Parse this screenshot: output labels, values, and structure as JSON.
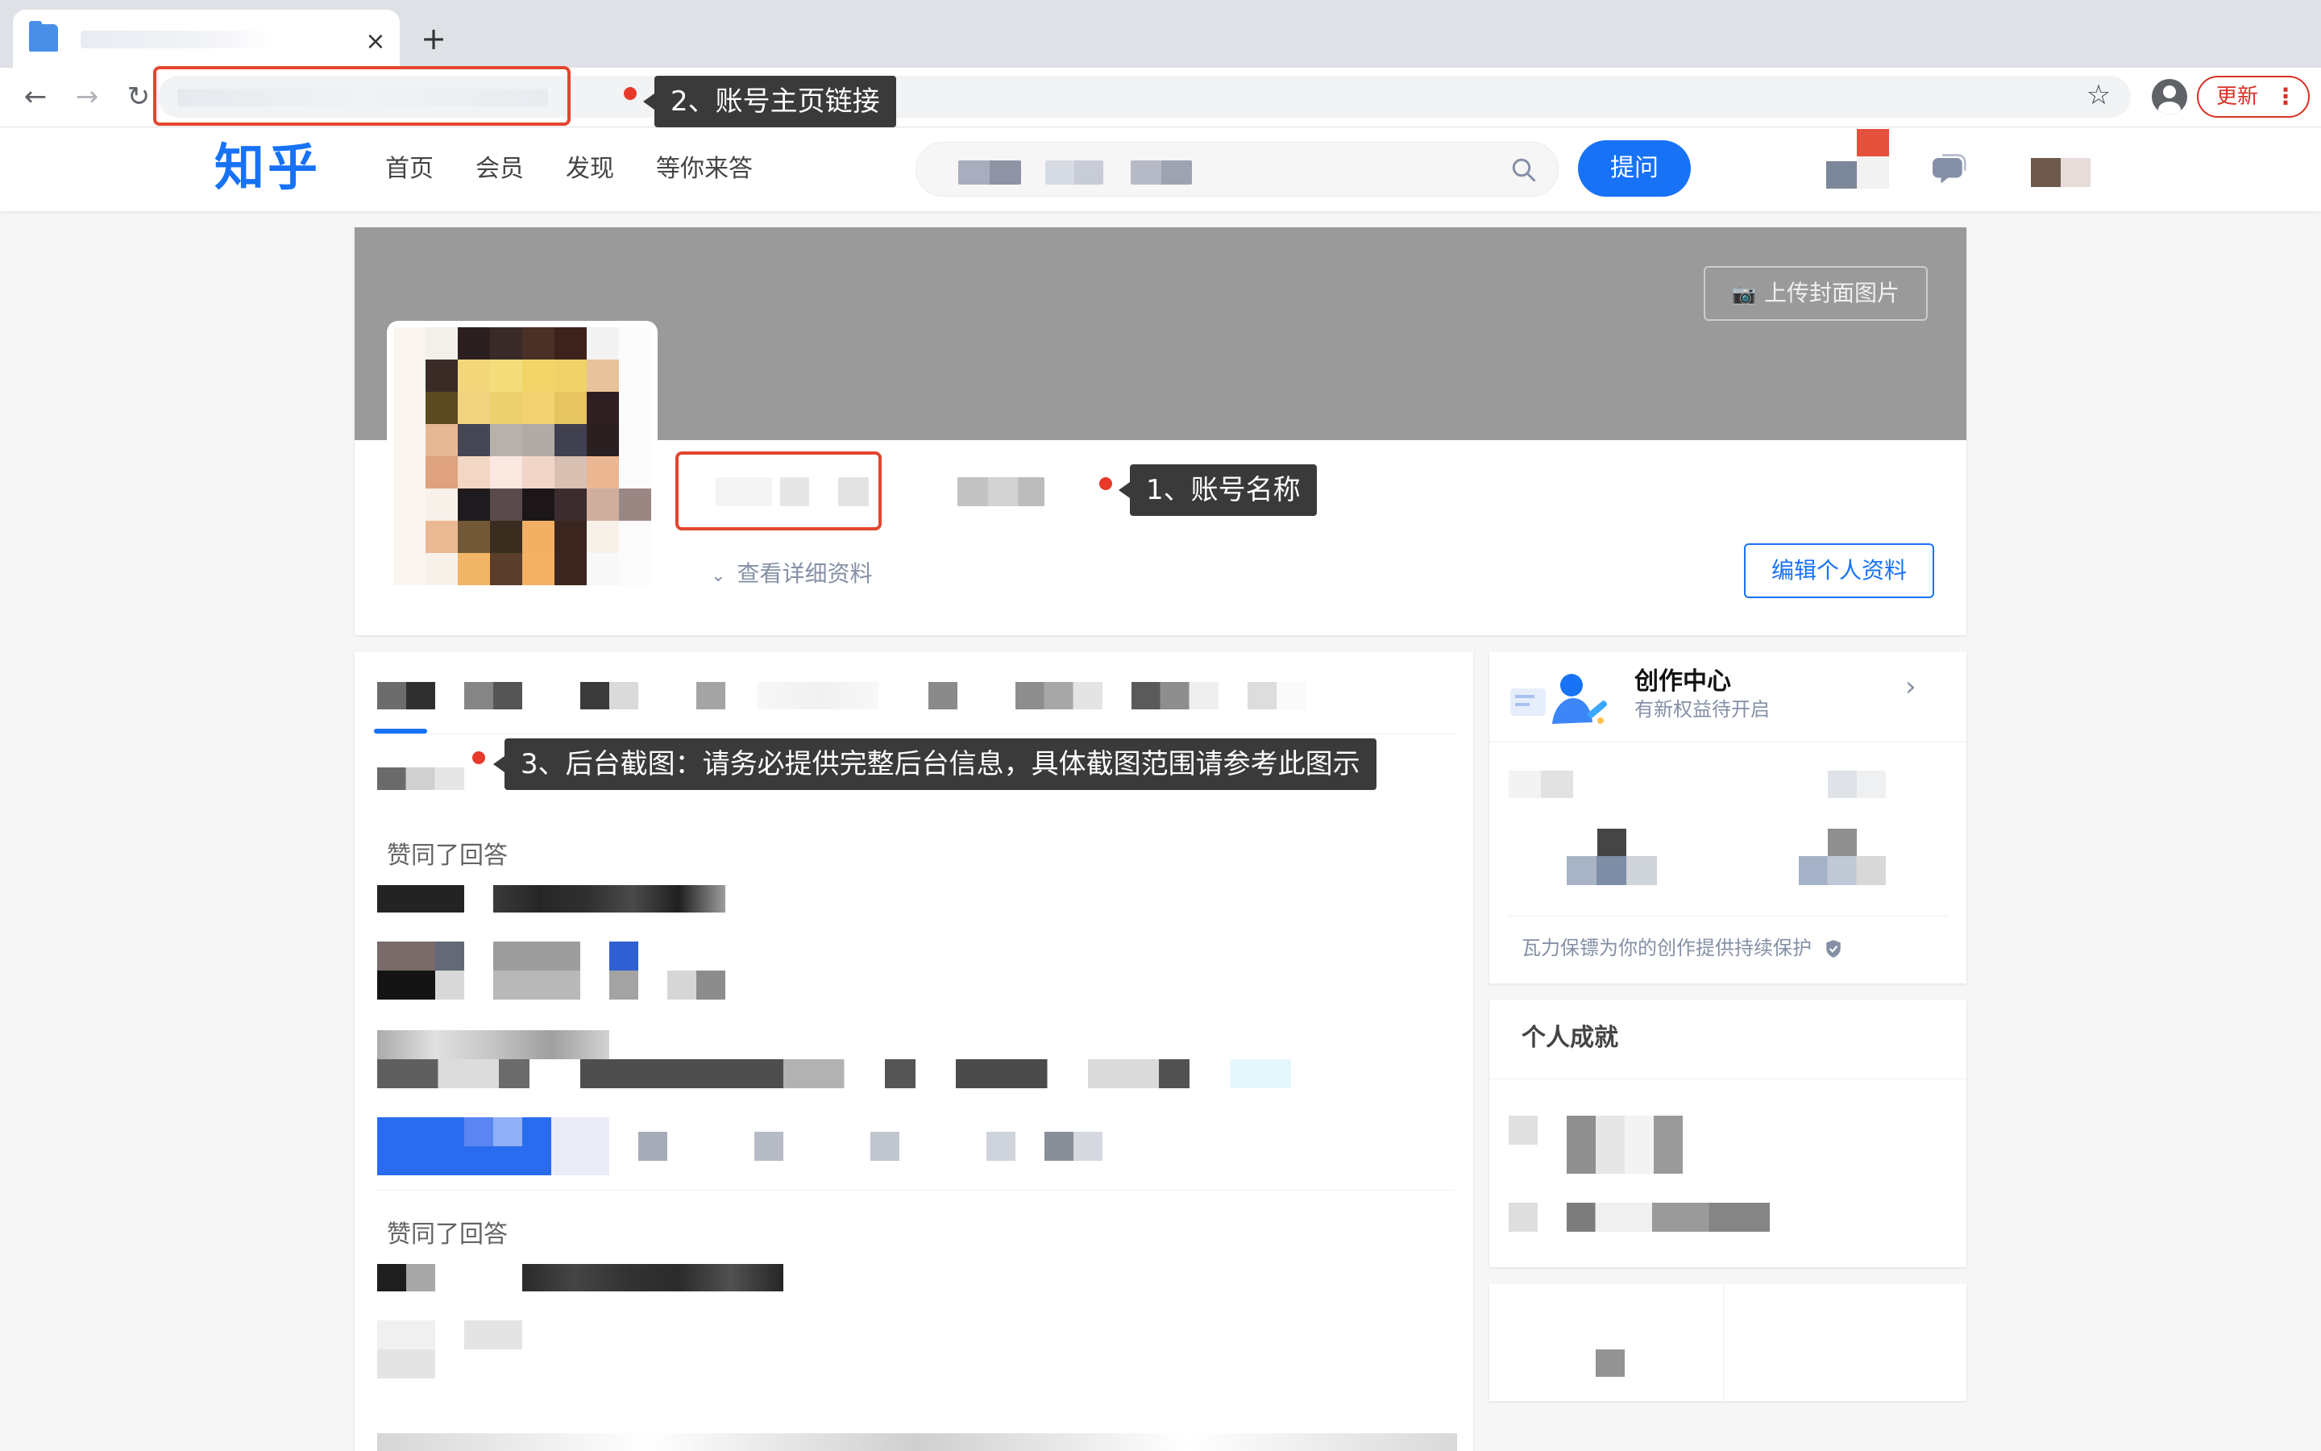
{
  "browser": {
    "tab_close": "×",
    "new_tab": "+",
    "back": "←",
    "forward": "→",
    "reload": "↻",
    "star": "☆",
    "update_label": "更新",
    "update_menu": "⋮"
  },
  "site": {
    "logo": "知乎",
    "nav": [
      "首页",
      "会员",
      "发现",
      "等你来答"
    ],
    "ask_label": "提问",
    "brand_color": "#1772f6"
  },
  "profile": {
    "upload_cover": "上传封面图片",
    "view_details": "查看详细资料",
    "edit_profile": "编辑个人资料"
  },
  "feed": {
    "activity_1": "赞同了回答",
    "activity_2": "赞同了回答"
  },
  "sidebar": {
    "creator_title": "创作中心",
    "creator_sub": "有新权益待开启",
    "protect_text": "瓦力保镖为你的创作提供持续保护",
    "achievements_title": "个人成就"
  },
  "annotations": {
    "callout_1": "1、账号名称",
    "callout_2": "2、账号主页链接",
    "callout_3": "3、后台截图：请务必提供完整后台信息，具体截图范围请参考此图示",
    "color": "#e3452f"
  }
}
